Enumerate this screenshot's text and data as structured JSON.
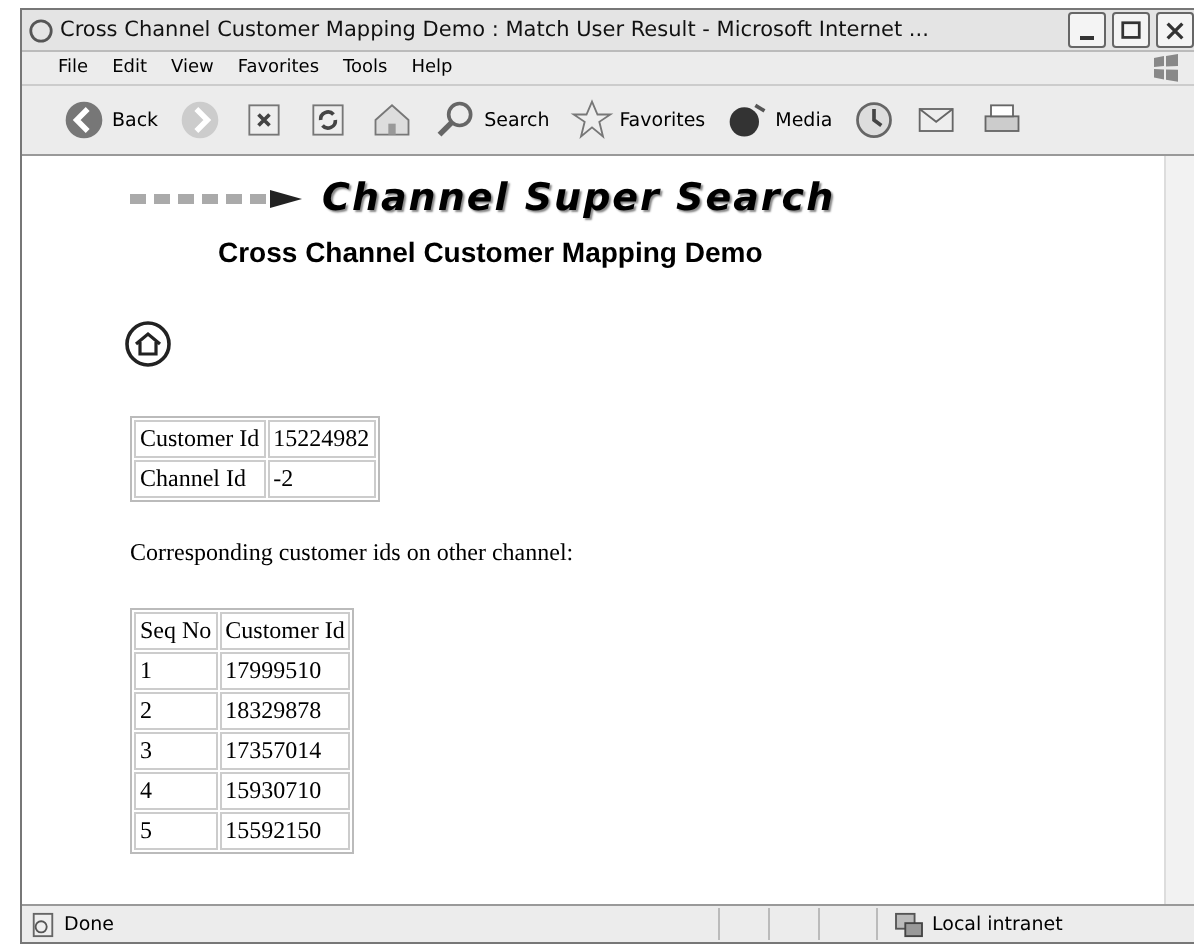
{
  "window": {
    "title": "Cross Channel Customer Mapping Demo : Match User Result - Microsoft Internet ..."
  },
  "menu": [
    "File",
    "Edit",
    "View",
    "Favorites",
    "Tools",
    "Help"
  ],
  "toolbar": [
    {
      "kind": "back",
      "label": "Back"
    },
    {
      "kind": "forward"
    },
    {
      "kind": "stop"
    },
    {
      "kind": "refresh"
    },
    {
      "kind": "home"
    },
    {
      "kind": "search",
      "label": "Search"
    },
    {
      "kind": "favorites",
      "label": "Favorites"
    },
    {
      "kind": "media",
      "label": "Media"
    },
    {
      "kind": "history"
    },
    {
      "kind": "mail"
    },
    {
      "kind": "print"
    }
  ],
  "page": {
    "banner": "Channel Super Search",
    "heading": "Cross Channel Customer Mapping Demo",
    "info": [
      [
        "Customer Id",
        "15224982"
      ],
      [
        "Channel Id",
        "-2"
      ]
    ],
    "caption": "Corresponding customer ids on other channel:",
    "results": {
      "columns": [
        "Seq No",
        "Customer Id"
      ],
      "rows": [
        [
          "1",
          "17999510"
        ],
        [
          "2",
          "18329878"
        ],
        [
          "3",
          "17357014"
        ],
        [
          "4",
          "15930710"
        ],
        [
          "5",
          "15592150"
        ]
      ]
    }
  },
  "status_bar": {
    "status": "Done",
    "zone": "Local intranet"
  }
}
